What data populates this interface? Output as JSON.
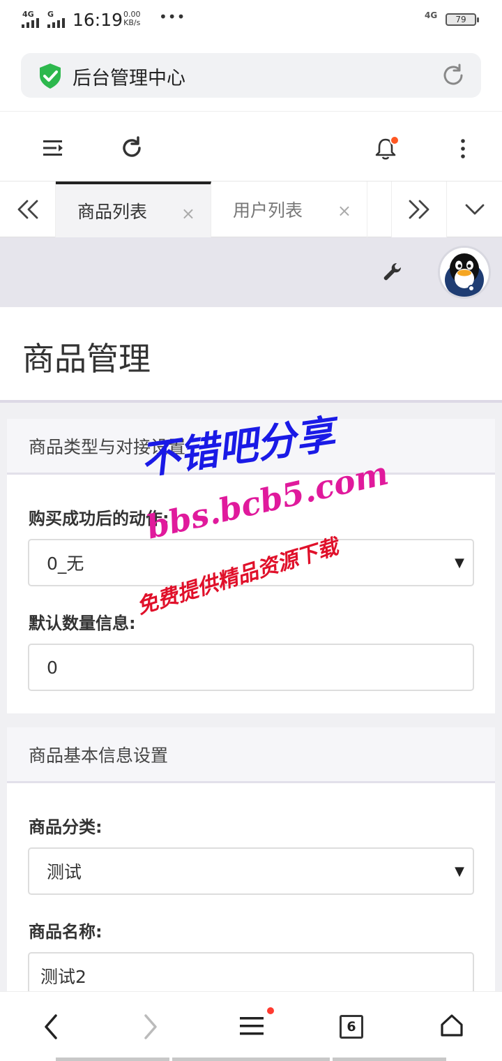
{
  "status_bar": {
    "signal_left": "4G",
    "signal_right_label": "G",
    "time": "16:19",
    "speed_value": "0.00",
    "speed_unit": "KB/s",
    "more": "•••",
    "network_right": "4G",
    "battery": "79"
  },
  "address_bar": {
    "title": "后台管理中心",
    "shield_icon": "shield-check-icon",
    "reload_icon": "reload-icon"
  },
  "toolbar": {
    "menu_icon": "menu-indent-icon",
    "refresh_icon": "refresh-icon",
    "bell_icon": "bell-icon",
    "more_icon": "more-vertical-icon"
  },
  "tabs": {
    "prev_icon": "double-chevron-left-icon",
    "next_icon": "double-chevron-right-icon",
    "dropdown_icon": "chevron-down-icon",
    "items": [
      {
        "label": "商品列表",
        "close": "×"
      },
      {
        "label": "用户列表",
        "close": "×"
      }
    ]
  },
  "userbar": {
    "wrench_icon": "wrench-icon",
    "avatar": "qq-penguin-avatar"
  },
  "page": {
    "title": "商品管理"
  },
  "section1": {
    "title": "商品类型与对接设置",
    "action_label": "购买成功后的动作:",
    "action_value": "0_无",
    "qty_label": "默认数量信息:",
    "qty_value": "0"
  },
  "section2": {
    "title": "商品基本信息设置",
    "category_label": "商品分类:",
    "category_value": "测试",
    "name_label": "商品名称:",
    "name_value": "测试2"
  },
  "watermark": {
    "line1": "不错吧分享",
    "line2": "bbs.bcb5.com",
    "line3": "免费提供精品资源下载"
  },
  "bottom_nav": {
    "back_icon": "chevron-left-icon",
    "forward_icon": "chevron-right-icon",
    "menu_icon": "hamburger-icon",
    "tabs_count": "6",
    "home_icon": "home-icon"
  },
  "colors": {
    "accent_orange": "#ff5722",
    "shield_green": "#2db84d",
    "watermark_blue": "#1a1ae6",
    "watermark_magenta": "#e01a9c",
    "watermark_red": "#e0102a"
  }
}
